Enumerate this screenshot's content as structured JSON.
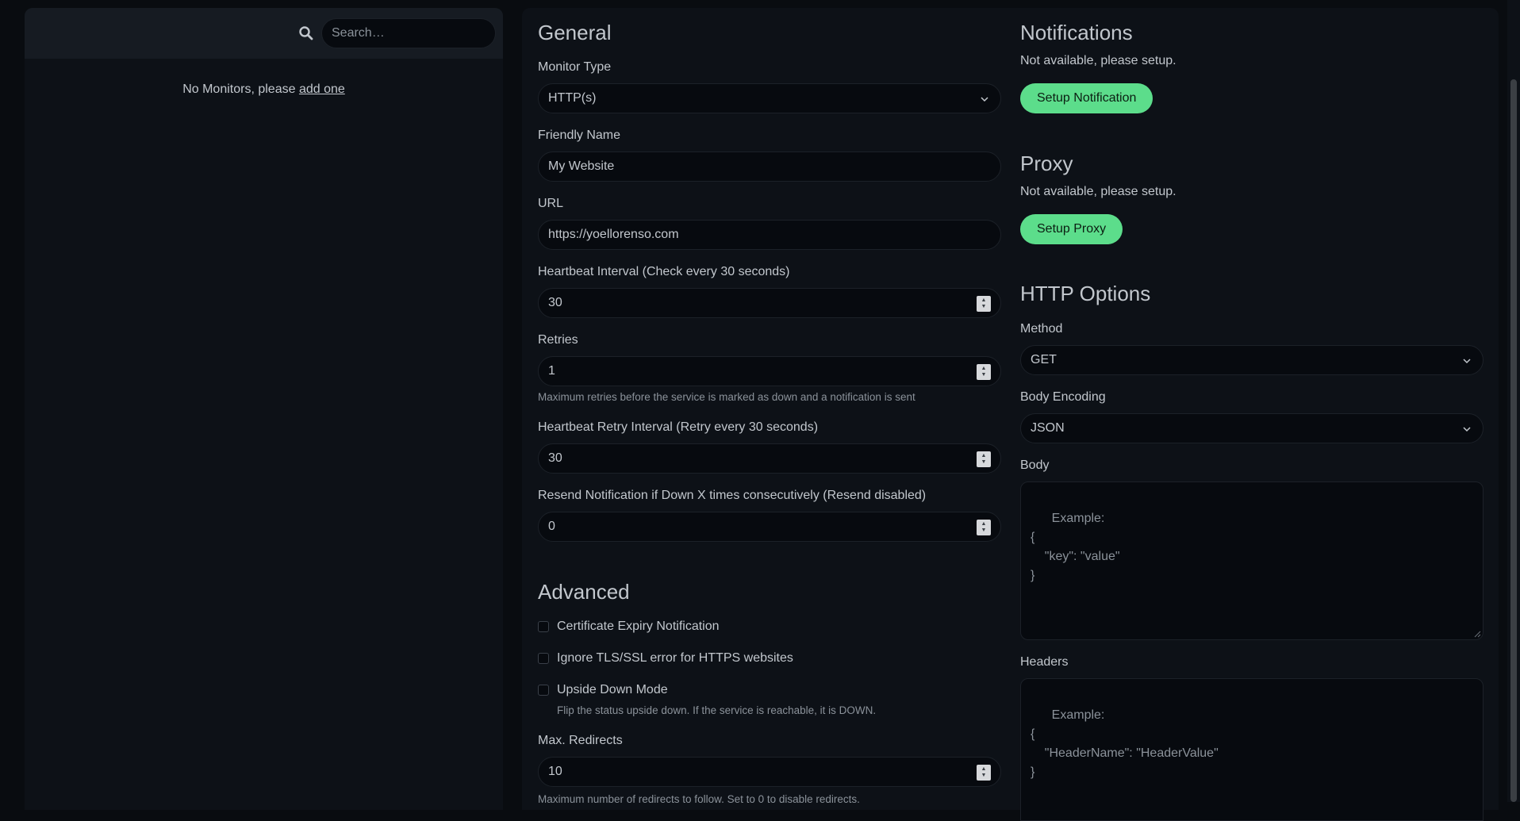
{
  "sidebar": {
    "search_placeholder": "Search…",
    "empty_prefix": "No Monitors, please ",
    "empty_link": "add one"
  },
  "general": {
    "heading": "General",
    "monitor_type_label": "Monitor Type",
    "monitor_type_value": "HTTP(s)",
    "friendly_name_label": "Friendly Name",
    "friendly_name_value": "My Website",
    "url_label": "URL",
    "url_value": "https://yoellorenso.com",
    "interval_label": "Heartbeat Interval (Check every 30 seconds)",
    "interval_value": "30",
    "retries_label": "Retries",
    "retries_value": "1",
    "retries_help": "Maximum retries before the service is marked as down and a notification is sent",
    "retry_interval_label": "Heartbeat Retry Interval (Retry every 30 seconds)",
    "retry_interval_value": "30",
    "resend_label": "Resend Notification if Down X times consecutively (Resend disabled)",
    "resend_value": "0"
  },
  "advanced": {
    "heading": "Advanced",
    "cert_expiry_label": "Certificate Expiry Notification",
    "ignore_tls_label": "Ignore TLS/SSL error for HTTPS websites",
    "upside_down_label": "Upside Down Mode",
    "upside_down_help": "Flip the status upside down. If the service is reachable, it is DOWN.",
    "max_redirects_label": "Max. Redirects",
    "max_redirects_value": "10",
    "max_redirects_help": "Maximum number of redirects to follow. Set to 0 to disable redirects."
  },
  "notifications": {
    "heading": "Notifications",
    "status": "Not available, please setup.",
    "button": "Setup Notification"
  },
  "proxy": {
    "heading": "Proxy",
    "status": "Not available, please setup.",
    "button": "Setup Proxy"
  },
  "http_options": {
    "heading": "HTTP Options",
    "method_label": "Method",
    "method_value": "GET",
    "body_encoding_label": "Body Encoding",
    "body_encoding_value": "JSON",
    "body_label": "Body",
    "body_placeholder": "Example:\n{\n    \"key\": \"value\"\n}",
    "headers_label": "Headers",
    "headers_placeholder": "Example:\n{\n    \"HeaderName\": \"HeaderValue\"\n}"
  },
  "colors": {
    "background": "#090c10",
    "panel": "#0d1117",
    "accent_green": "#5cdd8b"
  },
  "icons": [
    "search-icon",
    "chevron-down-icon",
    "spinner-icon",
    "resize-grip-icon"
  ]
}
